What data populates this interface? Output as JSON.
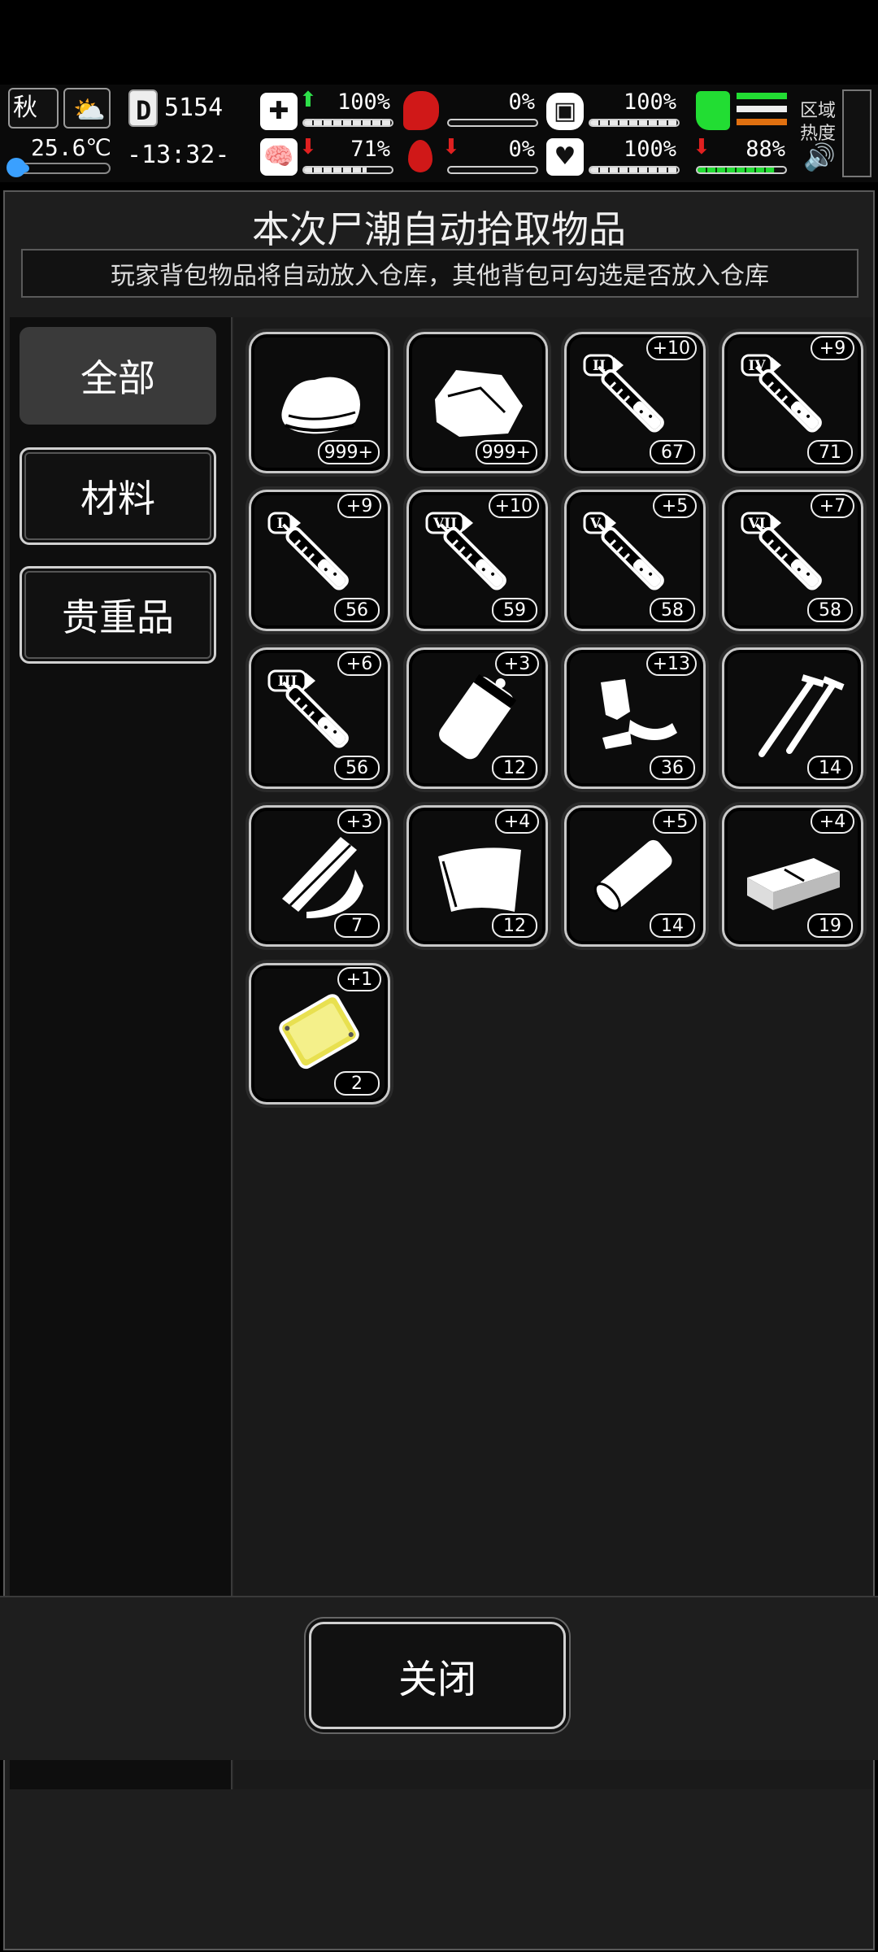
{
  "hud": {
    "season": "秋",
    "temperature": "25.6℃",
    "day_prefix": "D",
    "day": "5154",
    "clock": "-13:32-",
    "health_pct": "100%",
    "hunger_pct": "0%",
    "water_pct": "100%",
    "mood_pct": "71%",
    "bleed_pct": "0%",
    "heart_pct": "100%",
    "stamina_pct": "88%",
    "region_label": "区域\n热度",
    "region_line1": "区域",
    "region_line2": "热度",
    "health_level": 1.0,
    "hunger_level": 0.0,
    "water_level": 1.0,
    "mood_level": 0.71,
    "bleed_level": 0.0,
    "heart_level": 1.0,
    "stamina_level": 0.88,
    "temp_level": 0.2
  },
  "panel": {
    "title": "本次尸潮自动拾取物品",
    "subtitle": "玩家背包物品将自动放入仓库，其他背包可勾选是否放入仓库"
  },
  "categories": [
    {
      "label": "全部",
      "active": true
    },
    {
      "label": "材料",
      "active": false
    },
    {
      "label": "贵重品",
      "active": false
    }
  ],
  "items": [
    {
      "icon": "cloth-icon",
      "count": "999+",
      "plus": ""
    },
    {
      "icon": "leather-icon",
      "count": "999+",
      "plus": ""
    },
    {
      "icon": "syringe-ii-icon",
      "count": "67",
      "plus": "+10",
      "roman": "II"
    },
    {
      "icon": "syringe-iv-icon",
      "count": "71",
      "plus": "+9",
      "roman": "IV"
    },
    {
      "icon": "syringe-i-icon",
      "count": "56",
      "plus": "+9",
      "roman": "I"
    },
    {
      "icon": "syringe-vii-icon",
      "count": "59",
      "plus": "+10",
      "roman": "VII"
    },
    {
      "icon": "syringe-v-icon",
      "count": "58",
      "plus": "+5",
      "roman": "V"
    },
    {
      "icon": "syringe-vi-icon",
      "count": "58",
      "plus": "+7",
      "roman": "VI"
    },
    {
      "icon": "syringe-iii-icon",
      "count": "56",
      "plus": "+6",
      "roman": "III"
    },
    {
      "icon": "plastic-bag-icon",
      "count": "12",
      "plus": "+3"
    },
    {
      "icon": "scrap-parts-icon",
      "count": "36",
      "plus": "+13"
    },
    {
      "icon": "nails-icon",
      "count": "14",
      "plus": ""
    },
    {
      "icon": "wood-planks-icon",
      "count": "7",
      "plus": "+3"
    },
    {
      "icon": "cloth-sheet-icon",
      "count": "12",
      "plus": "+4"
    },
    {
      "icon": "log-icon",
      "count": "14",
      "plus": "+5"
    },
    {
      "icon": "brick-icon",
      "count": "19",
      "plus": "+4"
    },
    {
      "icon": "gold-plate-icon",
      "count": "2",
      "plus": "+1"
    }
  ],
  "close_label": "关闭",
  "colors": {
    "accent_green": "#22dd33",
    "alert_red": "#e02020",
    "gold": "#e8e050"
  }
}
